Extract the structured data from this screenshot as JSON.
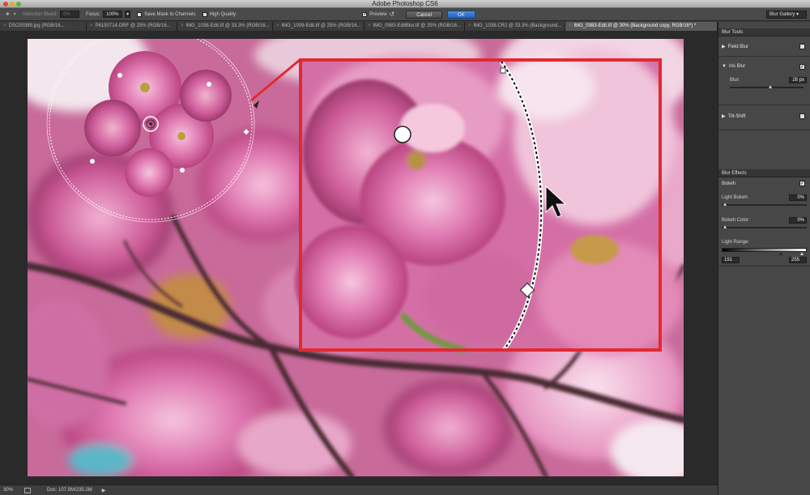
{
  "app": {
    "title": "Adobe Photoshop CS6"
  },
  "options": {
    "selection_bleed_label": "Selection Bleed:",
    "selection_bleed_value": "0%",
    "focus_label": "Focus:",
    "focus_value": "100%",
    "save_mask_label": "Save Mask to Channels",
    "high_quality_label": "High Quality",
    "preview_label": "Preview",
    "cancel_label": "Cancel",
    "ok_label": "OK",
    "workspace_select": "Blur Gallery"
  },
  "tabs": [
    "DSC00389.jpg (RGB/16...",
    "P6150714.ORF @ 25% (RGB/16...",
    "IMG_1038-Edit.tif @ 33.3% (RGB/16...",
    "IMG_1009-Edit.tif @ 25% (RGB/16...",
    "IMG_0983-EditBlur.tif @ 25% (RGB/16...",
    "IMG_1038.CR2 @ 33.3% (Background...",
    "IMG_0983-Edit.tif @ 30% (Background copy, RGB/16*) *"
  ],
  "status": {
    "zoom": "30%",
    "doc": "Doc: 107.5M/235.2M"
  },
  "panel": {
    "title": "Blur Tools",
    "field_blur": "Field Blur",
    "iris_blur": "Iris Blur",
    "blur_label": "Blur:",
    "blur_value": "28 px",
    "blur_fraction": 0.55,
    "tilt_shift": "Tilt-Shift",
    "effects_title": "Blur Effects",
    "bokeh_label": "Bokeh",
    "light_bokeh_label": "Light Bokeh:",
    "light_bokeh_value": "0%",
    "bokeh_color_label": "Bokeh Color:",
    "bokeh_color_value": "0%",
    "light_range_label": "Light Range:",
    "range_low": "191",
    "range_high": "255"
  },
  "colors": {
    "zoom_frame": "#e02a30",
    "blossom": "#d9589a"
  }
}
